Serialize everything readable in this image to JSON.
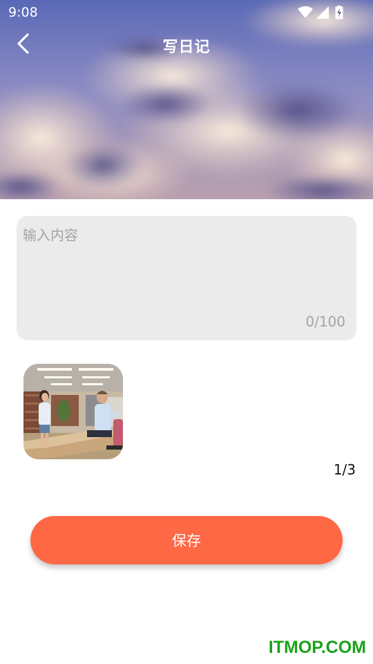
{
  "status_bar": {
    "time": "9:08",
    "icons": [
      "wifi-icon",
      "cellular-signal-icon",
      "battery-charging-icon"
    ]
  },
  "header": {
    "title": "写日记",
    "back_icon": "chevron-left-icon",
    "background": "sunset-clouds-photo"
  },
  "content": {
    "placeholder": "输入内容",
    "value": "",
    "counter": "0/100"
  },
  "photos": {
    "count_label": "1/3",
    "items": [
      "library-photo"
    ]
  },
  "actions": {
    "save_label": "保存"
  },
  "colors": {
    "accent": "#ff6845",
    "input_bg": "#ebebeb",
    "placeholder": "#a4a4a4",
    "watermark": "#19a319"
  },
  "watermark": "ITMOP.COM"
}
